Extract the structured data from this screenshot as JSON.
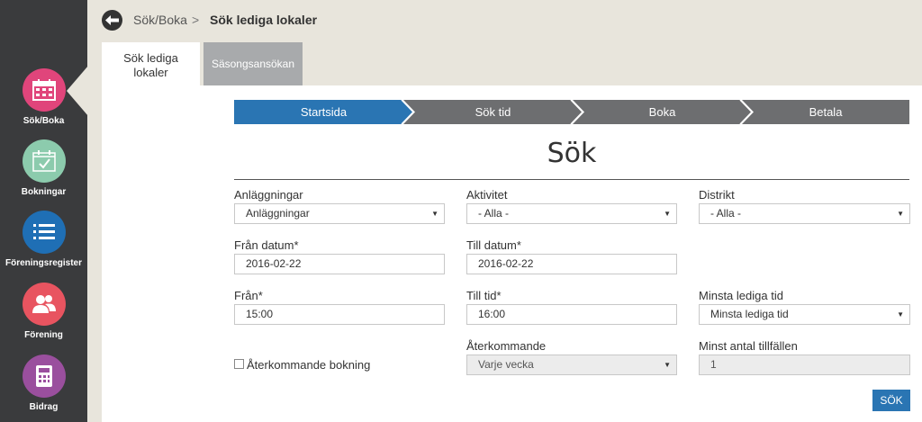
{
  "sidebar": {
    "items": [
      {
        "label": "Sök/Boka",
        "icon": "calendar-icon",
        "color": "#e0457b"
      },
      {
        "label": "Bokningar",
        "icon": "calendar-check-icon",
        "color": "#8ccbad"
      },
      {
        "label": "Föreningsregister",
        "icon": "list-icon",
        "color": "#1f6fb5"
      },
      {
        "label": "Förening",
        "icon": "users-icon",
        "color": "#e85460"
      },
      {
        "label": "Bidrag",
        "icon": "calculator-icon",
        "color": "#9a4f9e"
      }
    ]
  },
  "breadcrumb": {
    "parent": "Sök/Boka",
    "separator": ">",
    "current": "Sök lediga lokaler"
  },
  "tabs": [
    {
      "label": "Sök lediga lokaler",
      "active": true
    },
    {
      "label": "Säsongsansökan",
      "active": false
    }
  ],
  "steps": [
    {
      "label": "Startsida",
      "active": true
    },
    {
      "label": "Sök tid",
      "active": false
    },
    {
      "label": "Boka",
      "active": false
    },
    {
      "label": "Betala",
      "active": false
    }
  ],
  "colors": {
    "step_active": "#2a75b3",
    "step_inactive": "#6d6e70",
    "button": "#2a75b3"
  },
  "form": {
    "title": "Sök",
    "anlaggningar": {
      "label": "Anläggningar",
      "value": "Anläggningar"
    },
    "aktivitet": {
      "label": "Aktivitet",
      "value": "- Alla -"
    },
    "distrikt": {
      "label": "Distrikt",
      "value": "- Alla -"
    },
    "fran_datum": {
      "label": "Från datum*",
      "value": "2016-02-22"
    },
    "till_datum": {
      "label": "Till datum*",
      "value": "2016-02-22"
    },
    "fran": {
      "label": "Från*",
      "value": "15:00"
    },
    "till_tid": {
      "label": "Till tid*",
      "value": "16:00"
    },
    "minsta_lediga_tid": {
      "label": "Minsta lediga tid",
      "value": "Minsta lediga tid"
    },
    "aterkommande_bokning": {
      "label": "Återkommande bokning",
      "checked": false
    },
    "aterkommande": {
      "label": "Återkommande",
      "value": "Varje vecka"
    },
    "minst_antal": {
      "label": "Minst antal tillfällen",
      "value": "1"
    },
    "submit_label": "SÖK"
  }
}
